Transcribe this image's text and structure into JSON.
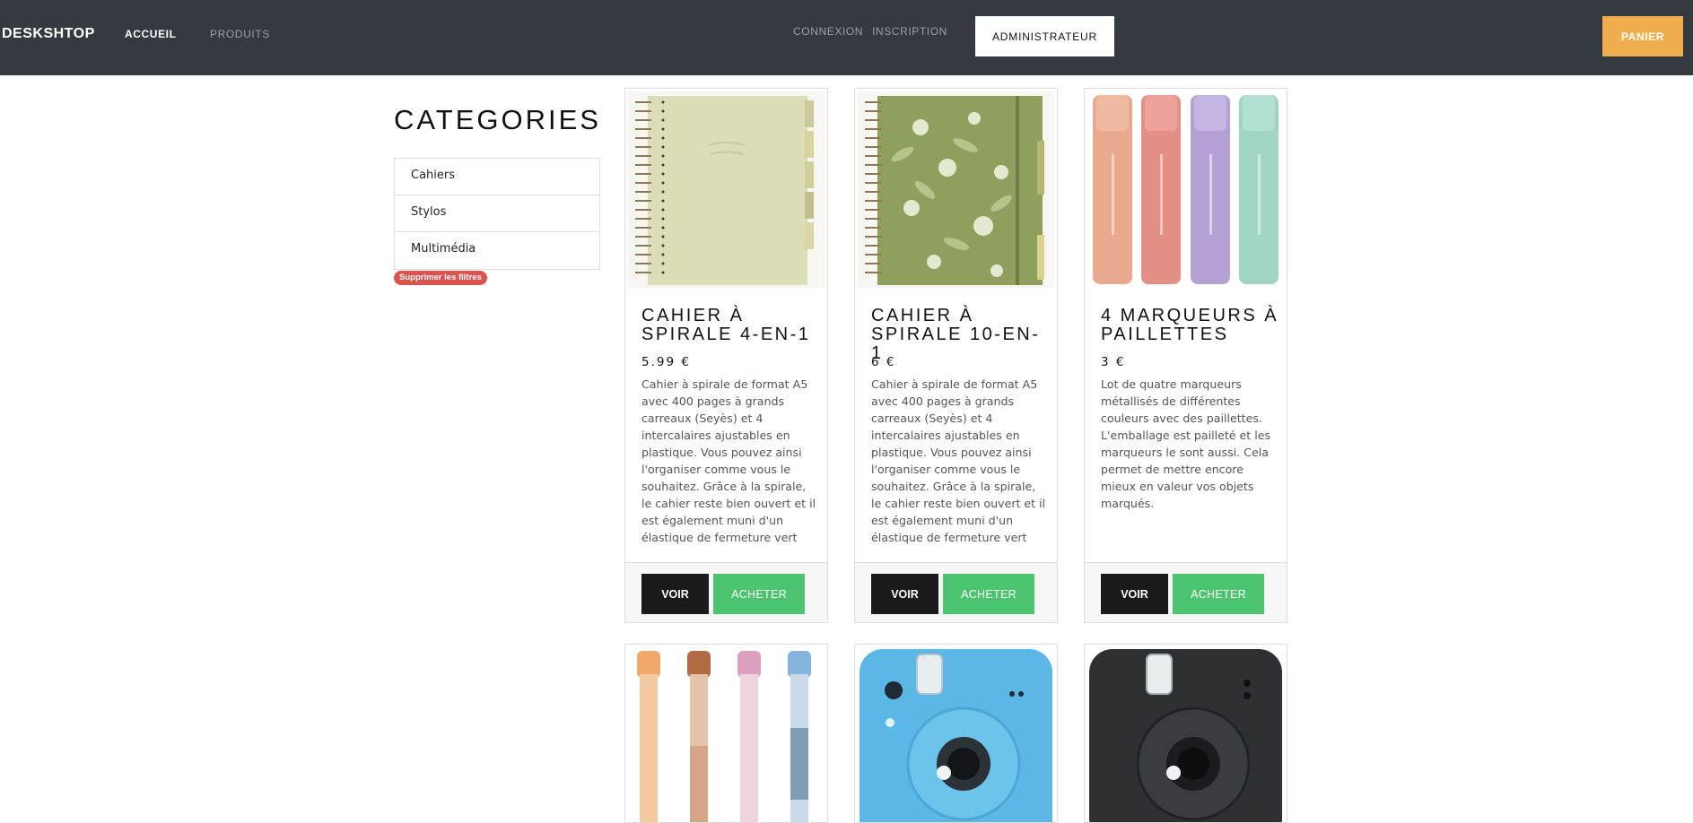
{
  "navbar": {
    "brand": "DESKSHTOP",
    "links": {
      "accueil": "ACCUEIL",
      "produits": "PRODUITS",
      "connexion": "CONNEXION",
      "inscription": "INSCRIPTION"
    },
    "admin_label": "ADMINISTRATEUR",
    "cart_label": "PANIER",
    "colors": {
      "background": "#343a40",
      "cart": "#f0ad4e"
    }
  },
  "sidebar": {
    "title": "CATEGORIES",
    "items": [
      {
        "label": "Cahiers"
      },
      {
        "label": "Stylos"
      },
      {
        "label": "Multimédia"
      }
    ],
    "clear_label": "Supprimer les filtres"
  },
  "products": [
    {
      "title": "CAHIER À SPIRALE 4-EN-1",
      "price": "5.99 €",
      "description": "Cahier à spirale de format A5 avec 400 pages à grands carreaux (Seyès) et 4 intercalaires ajustables en plastique. Vous pouvez ainsi l'organiser comme vous le souhaitez. Grâce à la spirale, le cahier reste bien ouvert et il est également muni d'un élastique de fermeture vert",
      "image_icon": "beige-spiral-notebook-image",
      "view_label": "VOIR",
      "buy_label": "ACHETER"
    },
    {
      "title": "CAHIER À SPIRALE 10-EN-1",
      "price": "6 €",
      "description": "Cahier à spirale de format A5 avec 400 pages à grands carreaux (Seyès) et 4 intercalaires ajustables en plastique. Vous pouvez ainsi l'organiser comme vous le souhaitez. Grâce à la spirale, le cahier reste bien ouvert et il est également muni d'un élastique de fermeture vert",
      "image_icon": "green-floral-spiral-notebook-image",
      "view_label": "VOIR",
      "buy_label": "ACHETER"
    },
    {
      "title": "4 MARQUEURS À PAILLETTES",
      "price": "3 €",
      "description": "Lot de quatre marqueurs métallisés de différentes couleurs avec des paillettes. L'emballage est pailleté et les marqueurs le sont aussi. Cela permet de mettre encore mieux en valeur vos objets marqués.",
      "image_icon": "glitter-markers-image",
      "view_label": "VOIR",
      "buy_label": "ACHETER"
    },
    {
      "image_icon": "pastel-paint-markers-image"
    },
    {
      "image_icon": "blue-instax-camera-image"
    },
    {
      "image_icon": "black-instax-camera-image"
    }
  ],
  "colors": {
    "voir": "#1a1a1a",
    "acheter": "#4cc46f",
    "clear_badge": "#d9534f"
  }
}
